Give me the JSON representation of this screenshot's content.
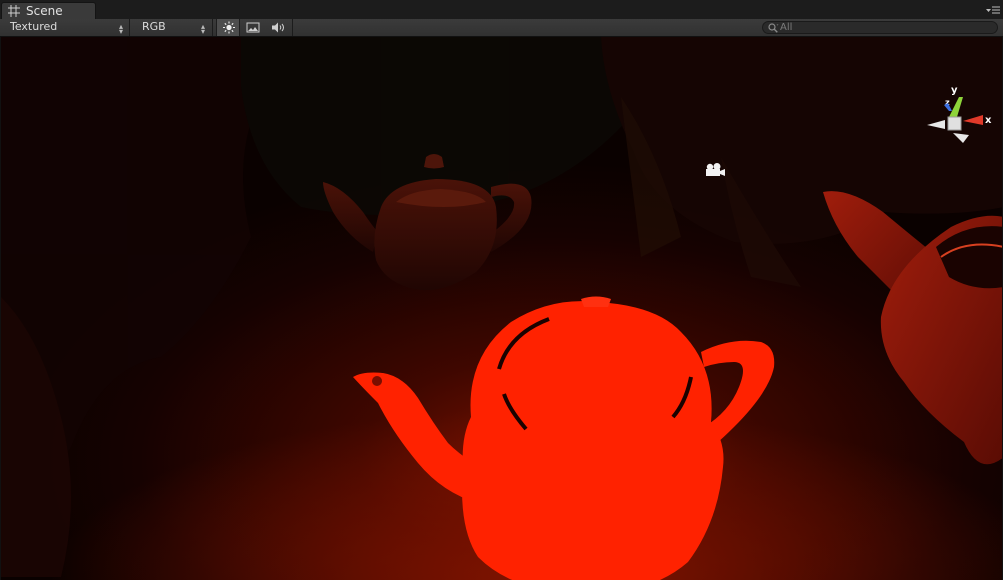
{
  "window": {
    "tab_label": "Scene",
    "tab_icon": "grid-icon",
    "menu_icon": "panel-menu-icon"
  },
  "toolbar": {
    "render_mode": "Textured",
    "color_mode": "RGB",
    "buttons": [
      {
        "name": "scene-lighting-toggle",
        "icon": "sun-icon",
        "active": true
      },
      {
        "name": "scene-overlay-toggle",
        "icon": "image-icon",
        "active": false
      },
      {
        "name": "scene-audio-toggle",
        "icon": "speaker-icon",
        "active": false
      }
    ],
    "search": {
      "placeholder": "All",
      "value": ""
    }
  },
  "gizmo": {
    "axis_labels": {
      "x": "x",
      "y": "y",
      "z": "z"
    },
    "colors": {
      "x": "#e03a2a",
      "y": "#8ed43a",
      "z": "#3a6ee0"
    }
  },
  "scene": {
    "objects": [
      "teapot-selected",
      "teapot-background",
      "teapot-right",
      "camera-icon"
    ],
    "colors": {
      "selected": "#ff2200",
      "background": "#0e0201",
      "foliage": "#1a0604"
    }
  }
}
